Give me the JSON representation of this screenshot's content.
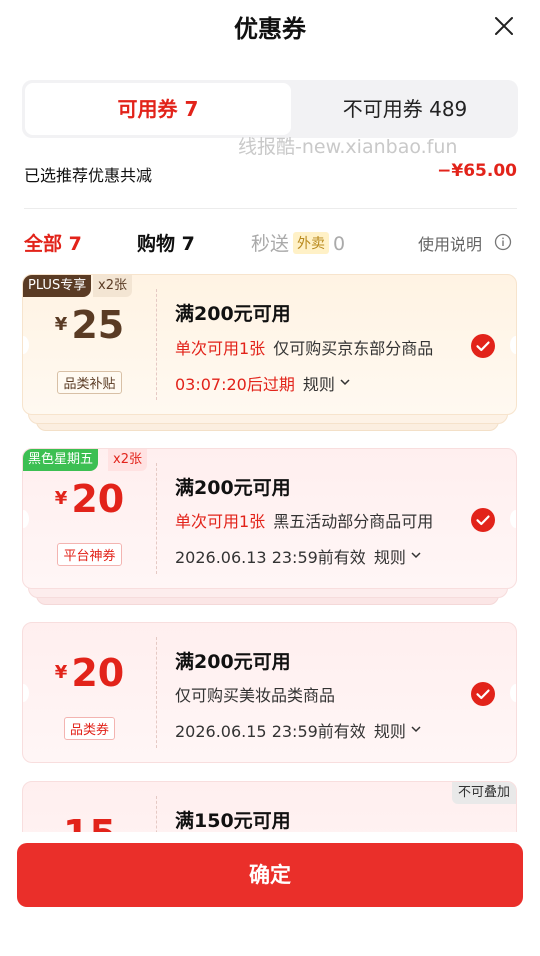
{
  "header": {
    "title": "优惠券"
  },
  "tabs": {
    "available_label": "可用券 7",
    "unavailable_label": "不可用券 489"
  },
  "watermark": "线报酷-new.xianbao.fun",
  "summary": {
    "label": "已选推荐优惠共减",
    "amount": "−¥65.00"
  },
  "filters": {
    "all": "全部 7",
    "shopping": "购物 7",
    "seckill": "秒送",
    "takeout": "外卖",
    "seckill_count": "0",
    "help": "使用说明"
  },
  "coupons": [
    {
      "badge": "PLUS专享",
      "count": "x2张",
      "currency": "¥",
      "amount": "25",
      "tag": "品类补贴",
      "title": "满200元可用",
      "limit": "单次可用1张",
      "scope": "仅可购买京东部分商品",
      "expiry": "03:07:20后过期",
      "rule": "规则",
      "selected": true
    },
    {
      "badge": "黑色星期五",
      "count": "x2张",
      "currency": "¥",
      "amount": "20",
      "tag": "平台神券",
      "title": "满200元可用",
      "limit": "单次可用1张",
      "scope": "黑五活动部分商品可用",
      "expiry": "2026.06.13 23:59前有效",
      "rule": "规则",
      "selected": true
    },
    {
      "currency": "¥",
      "amount": "20",
      "tag": "品类券",
      "title": "满200元可用",
      "scope": "仅可购买美妆品类商品",
      "expiry": "2026.06.15 23:59前有效",
      "rule": "规则",
      "selected": true
    },
    {
      "flag": "不可叠加",
      "amount": "15",
      "title": "满150元可用"
    }
  ],
  "footer": {
    "confirm_label": "确定"
  },
  "colors": {
    "accent": "#e2231a",
    "confirm": "#ea2f2a",
    "plus": "#5a3b24",
    "green_badge": "#3cbf52"
  }
}
